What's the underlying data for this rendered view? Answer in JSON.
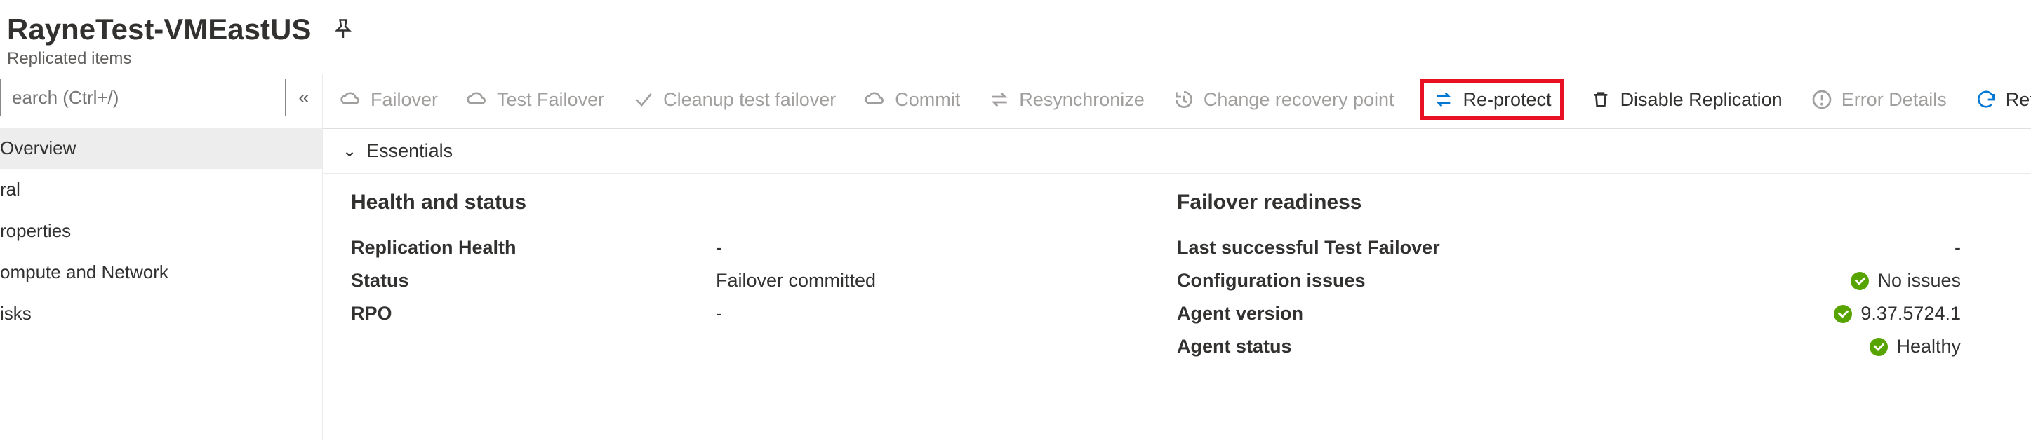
{
  "header": {
    "title": "RayneTest-VMEastUS",
    "subtitle": "Replicated items"
  },
  "sidebar": {
    "search_placeholder": "earch (Ctrl+/)",
    "items": [
      {
        "label": "Overview",
        "selected": true
      },
      {
        "label": "ral",
        "selected": false
      },
      {
        "label": "roperties",
        "selected": false
      },
      {
        "label": "ompute and Network",
        "selected": false
      },
      {
        "label": "isks",
        "selected": false
      }
    ]
  },
  "toolbar": {
    "failover": "Failover",
    "test_failover": "Test Failover",
    "cleanup": "Cleanup test failover",
    "commit": "Commit",
    "resync": "Resynchronize",
    "change_rp": "Change recovery point",
    "reprotect": "Re-protect",
    "disable_repl": "Disable Replication",
    "error_details": "Error Details",
    "refresh": "Refresh"
  },
  "essentials_label": "Essentials",
  "health": {
    "title": "Health and status",
    "rows": {
      "replication_health": {
        "k": "Replication Health",
        "v": "-"
      },
      "status": {
        "k": "Status",
        "v": "Failover committed"
      },
      "rpo": {
        "k": "RPO",
        "v": "-"
      }
    }
  },
  "readiness": {
    "title": "Failover readiness",
    "rows": {
      "last_tf": {
        "k": "Last successful Test Failover",
        "v": "-",
        "ok": false
      },
      "config_issues": {
        "k": "Configuration issues",
        "v": "No issues",
        "ok": true
      },
      "agent_version": {
        "k": "Agent version",
        "v": "9.37.5724.1",
        "ok": true
      },
      "agent_status": {
        "k": "Agent status",
        "v": "Healthy",
        "ok": true
      }
    }
  }
}
